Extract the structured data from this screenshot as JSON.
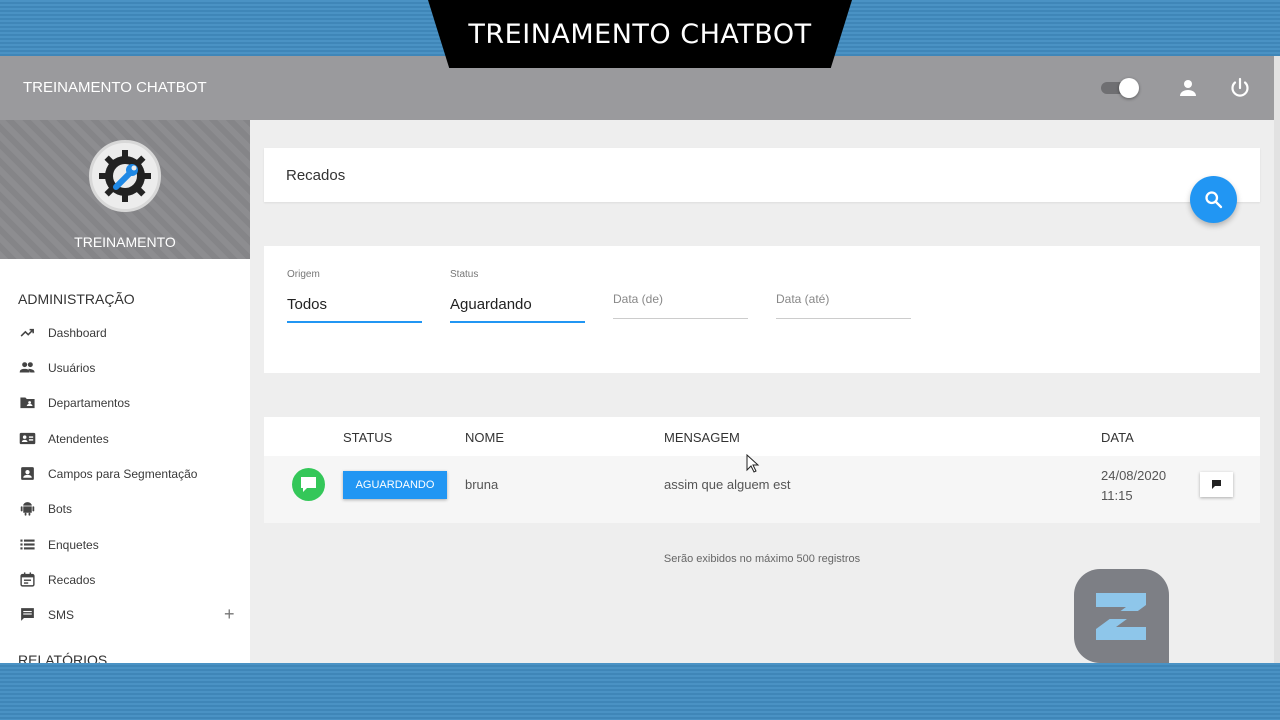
{
  "banner": {
    "title": "TREINAMENTO CHATBOT"
  },
  "topbar": {
    "app_title": "TREINAMENTO CHATBOT"
  },
  "profile": {
    "name": "TREINAMENTO"
  },
  "sidebar": {
    "section_admin": "ADMINISTRAÇÃO",
    "section_reports": "RELATÓRIOS",
    "items": [
      {
        "label": "Dashboard",
        "icon": "trending-up-icon"
      },
      {
        "label": "Usuários",
        "icon": "people-icon"
      },
      {
        "label": "Departamentos",
        "icon": "folder-shared-icon"
      },
      {
        "label": "Atendentes",
        "icon": "contact-card-icon"
      },
      {
        "label": "Campos para Segmentação",
        "icon": "account-box-icon"
      },
      {
        "label": "Bots",
        "icon": "android-icon"
      },
      {
        "label": "Enquetes",
        "icon": "list-icon"
      },
      {
        "label": "Recados",
        "icon": "calendar-icon"
      },
      {
        "label": "SMS",
        "icon": "message-icon",
        "expand": "+"
      }
    ]
  },
  "page": {
    "title": "Recados"
  },
  "filters": {
    "origem": {
      "label": "Origem",
      "value": "Todos"
    },
    "status": {
      "label": "Status",
      "value": "Aguardando"
    },
    "data_de": {
      "placeholder": "Data (de)"
    },
    "data_ate": {
      "placeholder": "Data (até)"
    }
  },
  "table": {
    "headers": {
      "status": "STATUS",
      "nome": "NOME",
      "mensagem": "MENSAGEM",
      "data": "DATA"
    },
    "rows": [
      {
        "status": "AGUARDANDO",
        "nome": "bruna",
        "mensagem": "assim que alguem est",
        "date": "24/08/2020",
        "time": "11:15"
      }
    ]
  },
  "footer_note": "Serão exibidos no máximo 500 registros",
  "colors": {
    "accent": "#2196f3",
    "topbar": "#9a9a9d",
    "chat_green": "#34c759"
  }
}
